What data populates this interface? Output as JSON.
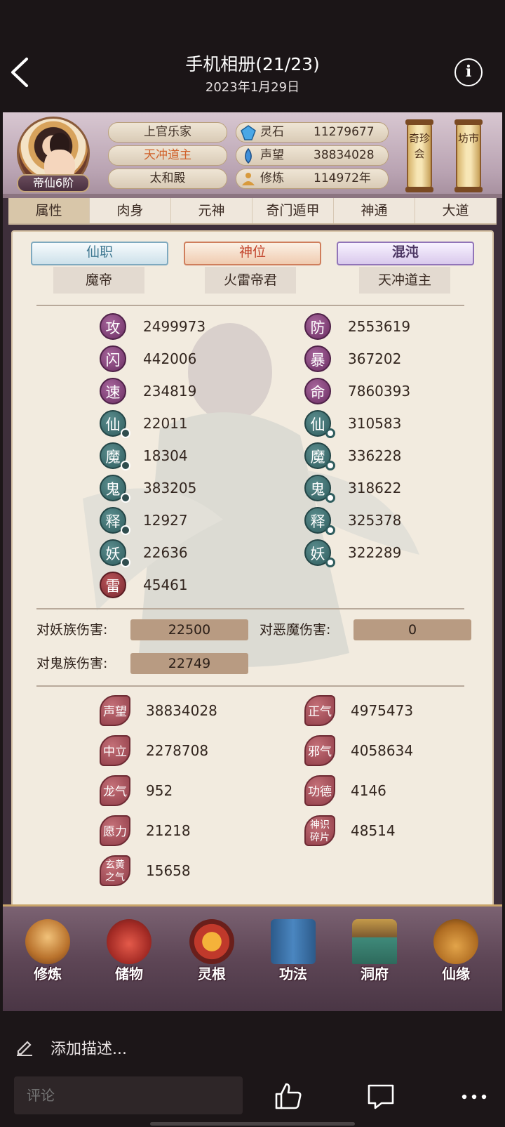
{
  "viewer": {
    "title": "手机相册(21/23)",
    "date": "2023年1月29日",
    "info_label": "i"
  },
  "game": {
    "player": {
      "rank": "帝仙6阶",
      "names": [
        "上官乐家",
        "天冲道主",
        "太和殿"
      ]
    },
    "stats": [
      {
        "label": "灵石",
        "value": "11279677",
        "icon": "gem-icon"
      },
      {
        "label": "声望",
        "value": "38834028",
        "icon": "crystal-icon"
      },
      {
        "label": "修炼",
        "value": "114972年",
        "icon": "meditate-icon"
      }
    ],
    "scrolls": [
      {
        "label": "奇珍会"
      },
      {
        "label": "坊市"
      }
    ],
    "tabs": [
      "属性",
      "肉身",
      "元神",
      "奇门遁甲",
      "神通",
      "大道"
    ],
    "titles": [
      {
        "heading": "仙职",
        "value": "魔帝"
      },
      {
        "heading": "神位",
        "value": "火雷帝君"
      },
      {
        "heading": "混沌",
        "value": "天冲道主"
      }
    ],
    "attributes_left": [
      {
        "icon": "攻",
        "value": "2499973"
      },
      {
        "icon": "闪",
        "value": "442006"
      },
      {
        "icon": "速",
        "value": "234819"
      },
      {
        "icon": "仙",
        "value": "22011"
      },
      {
        "icon": "魔",
        "value": "18304"
      },
      {
        "icon": "鬼",
        "value": "383205"
      },
      {
        "icon": "释",
        "value": "12927"
      },
      {
        "icon": "妖",
        "value": "22636"
      },
      {
        "icon": "雷",
        "value": "45461"
      }
    ],
    "attributes_right": [
      {
        "icon": "防",
        "value": "2553619"
      },
      {
        "icon": "暴",
        "value": "367202"
      },
      {
        "icon": "命",
        "value": "7860393"
      },
      {
        "icon": "仙",
        "value": "310583"
      },
      {
        "icon": "魔",
        "value": "336228"
      },
      {
        "icon": "鬼",
        "value": "318622"
      },
      {
        "icon": "释",
        "value": "325378"
      },
      {
        "icon": "妖",
        "value": "322289"
      }
    ],
    "damage": [
      {
        "label": "对妖族伤害:",
        "value": "22500"
      },
      {
        "label": "对恶魔伤害:",
        "value": "0"
      },
      {
        "label": "对鬼族伤害:",
        "value": "22749"
      }
    ],
    "reputation_left": [
      {
        "icon": "声望",
        "value": "38834028"
      },
      {
        "icon": "中立",
        "value": "2278708"
      },
      {
        "icon": "龙气",
        "value": "952"
      },
      {
        "icon": "愿力",
        "value": "21218"
      },
      {
        "icon": "玄黄之气",
        "value": "15658"
      }
    ],
    "reputation_right": [
      {
        "icon": "正气",
        "value": "4975473"
      },
      {
        "icon": "邪气",
        "value": "4058634"
      },
      {
        "icon": "功德",
        "value": "4146"
      },
      {
        "icon": "神识碎片",
        "value": "48514"
      }
    ],
    "menu": [
      "修炼",
      "储物",
      "灵根",
      "功法",
      "洞府",
      "仙缘"
    ]
  },
  "bottom": {
    "description_placeholder": "添加描述...",
    "comment_placeholder": "评论"
  }
}
